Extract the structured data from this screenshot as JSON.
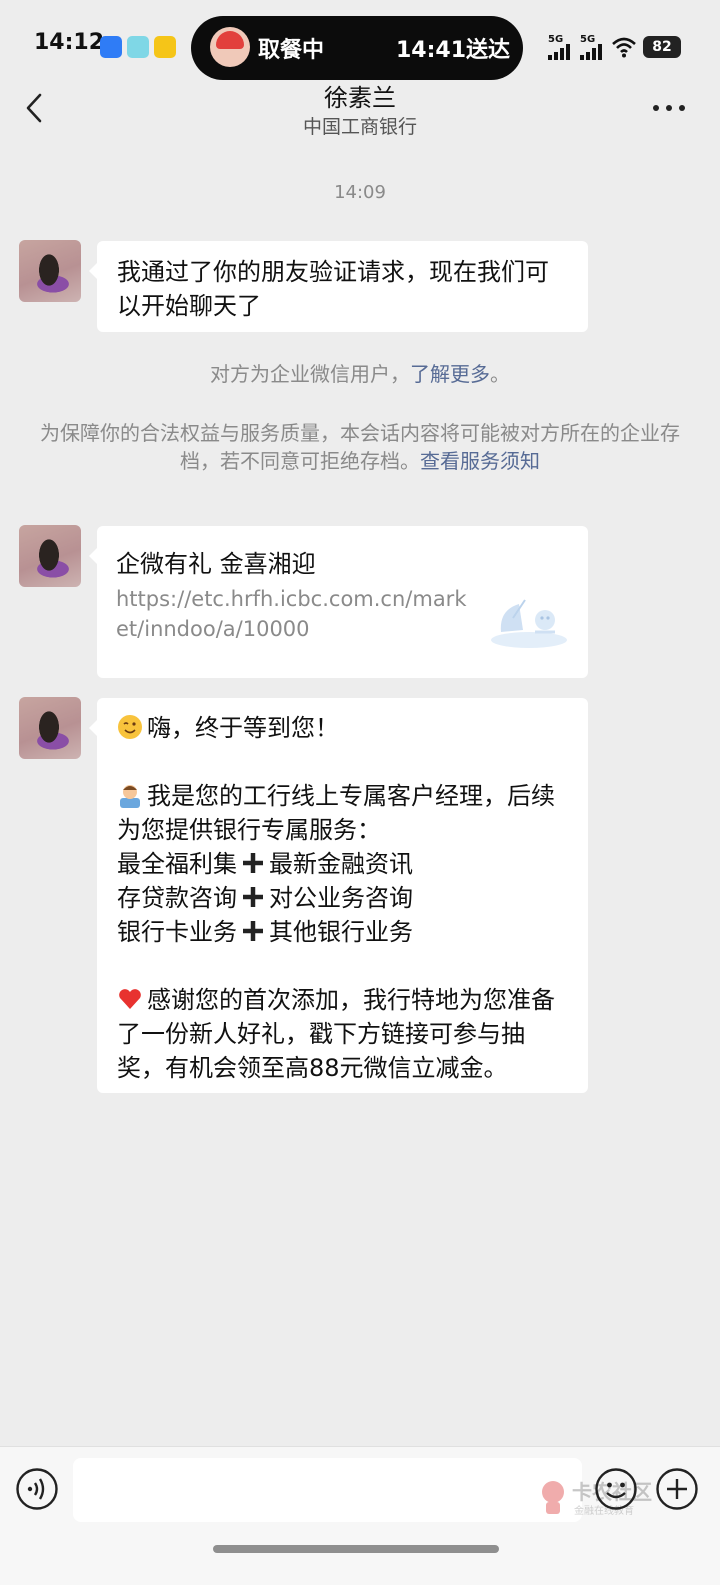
{
  "status_bar": {
    "time": "14:12",
    "island_left": "取餐中",
    "island_right": "14:41送达",
    "signal1_label": "5G",
    "signal2_label": "5G",
    "battery": "82"
  },
  "header": {
    "title": "徐素兰",
    "subtitle": "中国工商银行"
  },
  "chat": {
    "timestamp": "14:09",
    "msg1": "我通过了你的朋友验证请求，现在我们可以开始聊天了",
    "system1_text": "对方为企业微信用户，",
    "system1_link": "了解更多",
    "system1_end": "。",
    "system2_text": "为保障你的合法权益与服务质量，本会话内容将可能被对方所在的企业存档，若不同意可拒绝存档。",
    "system2_link": "查看服务须知",
    "card": {
      "title": "企微有礼 金喜湘迎",
      "url": "https://etc.hrfh.icbc.com.cn/market/inndoo/a/10000"
    },
    "msg3": {
      "line1": "嗨，终于等到您！",
      "para2": "我是您的工行线上专属客户经理，后续为您提供银行专属服务：",
      "row1_a": "最全福利集",
      "row1_b": "最新金融资讯",
      "row2_a": "存贷款咨询",
      "row2_b": "对公业务咨询",
      "row3_a": "银行卡业务",
      "row3_b": "其他银行业务",
      "para3": "感谢您的首次添加，我行特地为您准备了一份新人好礼，戳下方链接可参与抽奖，有机会领至高88元微信立减金。"
    }
  },
  "input": {
    "value": ""
  },
  "watermark": {
    "title": "卡农社区",
    "subtitle": "金融在线教育"
  },
  "colors": {
    "background": "#ededed",
    "link": "#576b95",
    "bubble": "#ffffff"
  }
}
